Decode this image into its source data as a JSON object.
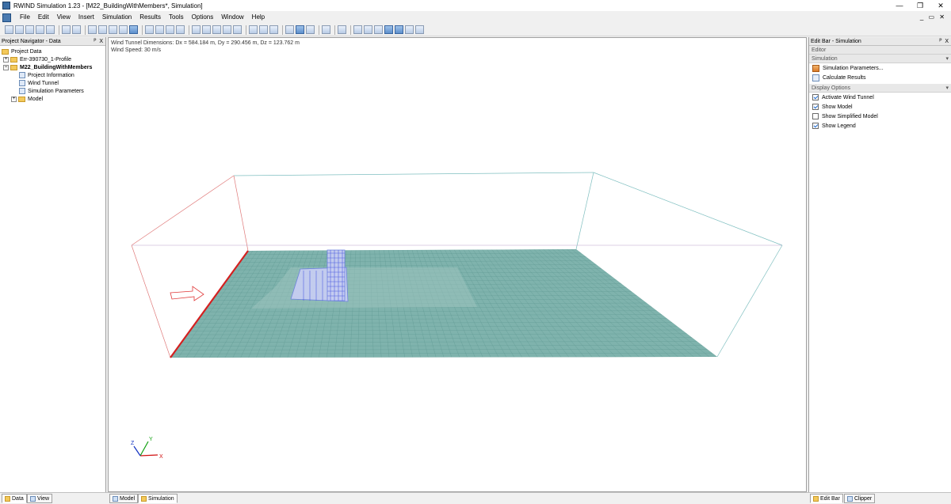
{
  "window": {
    "title": "RWIND Simulation 1.23 - [M22_BuildingWithMembers*, Simulation]",
    "controls": [
      "—",
      "❐",
      "✕"
    ]
  },
  "menu": {
    "items": [
      "File",
      "Edit",
      "View",
      "Insert",
      "Simulation",
      "Results",
      "Tools",
      "Options",
      "Window",
      "Help"
    ],
    "mdi_controls": "_ ▭ ✕"
  },
  "navigator": {
    "header": "Project Navigator - Data",
    "header_buttons": "ᴾ X",
    "items": [
      {
        "label": "Project Data",
        "level": 0,
        "expander": "",
        "icon": "folder"
      },
      {
        "label": "Err-390730_1-Profile",
        "level": 1,
        "expander": "+",
        "icon": "folder"
      },
      {
        "label": "M22_BuildingWithMembers",
        "level": 1,
        "expander": "−",
        "icon": "folder",
        "bold": true
      },
      {
        "label": "Project Information",
        "level": 2,
        "expander": "",
        "icon": "doc"
      },
      {
        "label": "Wind Tunnel",
        "level": 2,
        "expander": "",
        "icon": "doc"
      },
      {
        "label": "Simulation Parameters",
        "level": 2,
        "expander": "",
        "icon": "doc"
      },
      {
        "label": "Model",
        "level": 2,
        "expander": "+",
        "icon": "folder"
      }
    ]
  },
  "viewport": {
    "info_line1": "Wind Tunnel Dimensions: Dx = 584.184 m, Dy = 290.456 m, Dz = 123.762 m",
    "info_line2": "Wind Speed: 30 m/s",
    "axis_x": "X",
    "axis_y": "Y",
    "axis_z": "Z",
    "colors": {
      "ground": "#7fb3ad",
      "grid": "#5e9892",
      "inlet": "#d42020",
      "tunnel_left": "#e07a7a",
      "tunnel_right": "#7fbfc0",
      "building": "#8fa0e6",
      "arrow": "#e03a3a"
    }
  },
  "editbar": {
    "header": "Edit Bar - Simulation",
    "header_buttons": "ᴾ X",
    "sections": {
      "editor": "Editor",
      "simulation": "Simulation",
      "display": "Display Options"
    },
    "simulation_items": [
      "Simulation Parameters...",
      "Calculate Results"
    ],
    "display_options": [
      {
        "label": "Activate Wind Tunnel",
        "checked": true
      },
      {
        "label": "Show Model",
        "checked": true
      },
      {
        "label": "Show Simplified Model",
        "checked": false
      },
      {
        "label": "Show Legend",
        "checked": true
      }
    ]
  },
  "status": {
    "left_tabs": [
      "Data",
      "View"
    ],
    "center_tabs": [
      "Model",
      "Simulation"
    ],
    "right_tabs": [
      "Edit Bar",
      "Clipper"
    ]
  }
}
